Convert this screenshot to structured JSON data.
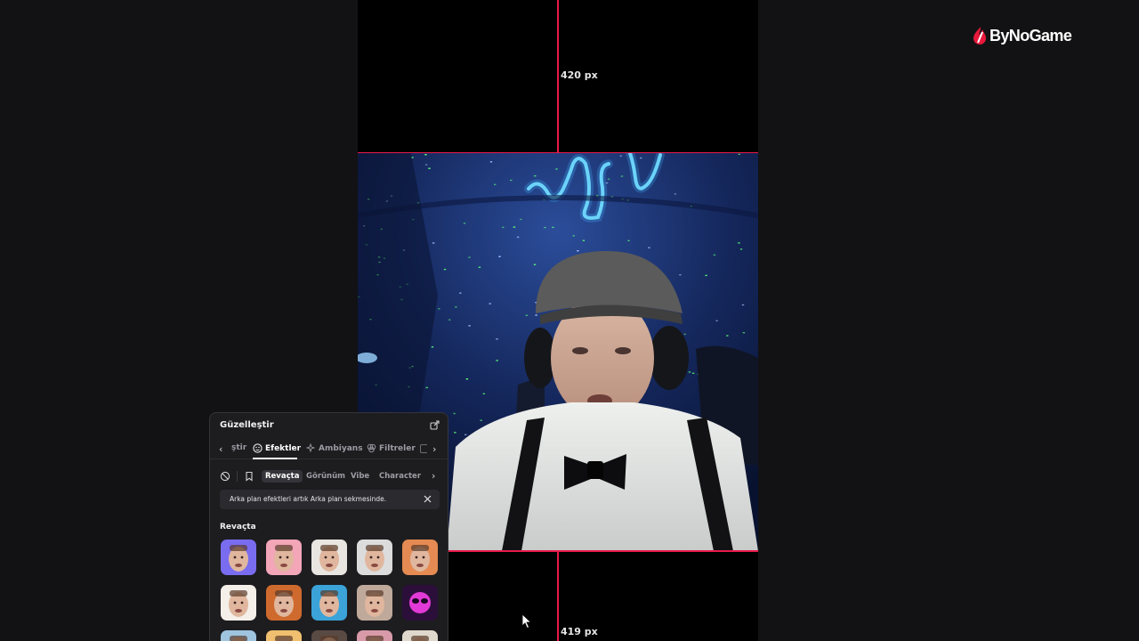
{
  "canvas": {
    "top_gap_label": "420 px",
    "bottom_gap_label": "419 px"
  },
  "logo": {
    "text": "ByNoGame",
    "brand_color": "#e8193c"
  },
  "panel": {
    "title": "Güzelleştir",
    "tabs": [
      {
        "label": "ştir",
        "icon": ""
      },
      {
        "label": "Efektler",
        "icon": "smile-icon",
        "active": true
      },
      {
        "label": "Ambiyans",
        "icon": "sparkle-icon"
      },
      {
        "label": "Filtreler",
        "icon": "filter-icon"
      }
    ],
    "subtabs": [
      {
        "label": "Revaçta",
        "active": true
      },
      {
        "label": "Görünüm"
      },
      {
        "label": "Vibe"
      },
      {
        "label": "Character"
      }
    ],
    "notice": "Arka plan efektleri artık Arka plan sekmesinde.",
    "section_title": "Revaçta",
    "thumbnails": [
      {
        "name": "old-man-effect",
        "bg": "#7a6cf0"
      },
      {
        "name": "pink-pig-effect",
        "bg": "#f2a6b8"
      },
      {
        "name": "cartoon-face-effect",
        "bg": "#e9e6e2"
      },
      {
        "name": "scream-face-effect",
        "bg": "#dcdcdc"
      },
      {
        "name": "big-lips-effect",
        "bg": "#e58a52"
      },
      {
        "name": "stretched-face-effect",
        "bg": "#f4efe8"
      },
      {
        "name": "burger-effect",
        "bg": "#cf6a2e"
      },
      {
        "name": "open-mouth-effect",
        "bg": "#3ba3d8"
      },
      {
        "name": "doll-face-effect",
        "bg": "#bfa99a"
      },
      {
        "name": "pink-alien-effect",
        "bg": "#2b0f3a"
      }
    ],
    "colors": {
      "accent": "#ffffff",
      "panel_bg": "#1d1d20"
    }
  },
  "guides": {
    "color": "#e8194a"
  }
}
